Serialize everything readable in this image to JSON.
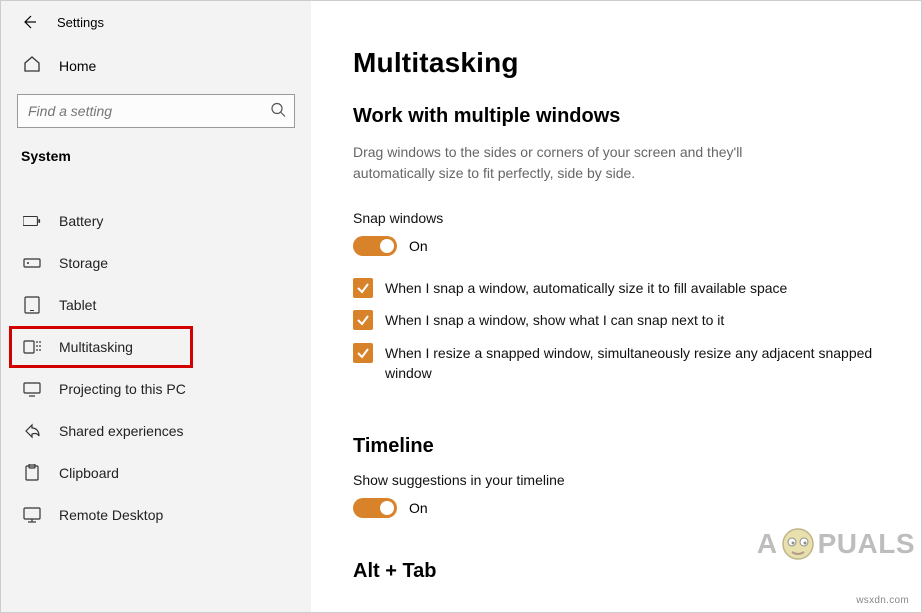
{
  "window": {
    "title": "Settings"
  },
  "sidebar": {
    "home": "Home",
    "search_placeholder": "Find a setting",
    "group": "System",
    "items": [
      {
        "label": "Battery"
      },
      {
        "label": "Storage"
      },
      {
        "label": "Tablet"
      },
      {
        "label": "Multitasking"
      },
      {
        "label": "Projecting to this PC"
      },
      {
        "label": "Shared experiences"
      },
      {
        "label": "Clipboard"
      },
      {
        "label": "Remote Desktop"
      }
    ]
  },
  "page": {
    "heading": "Multitasking",
    "section1": {
      "title": "Work with multiple windows",
      "desc": "Drag windows to the sides or corners of your screen and they'll automatically size to fit perfectly, side by side.",
      "snap_label": "Snap windows",
      "snap_state": "On",
      "opts": [
        "When I snap a window, automatically size it to fill available space",
        "When I snap a window, show what I can snap next to it",
        "When I resize a snapped window, simultaneously resize any adjacent snapped window"
      ]
    },
    "section2": {
      "title": "Timeline",
      "sugg_label": "Show suggestions in your timeline",
      "sugg_state": "On"
    },
    "section3": {
      "title": "Alt + Tab"
    }
  },
  "accent": "#d88329",
  "watermark": {
    "pre": "A",
    "post": "PUALS",
    "url": "wsxdn.com"
  }
}
